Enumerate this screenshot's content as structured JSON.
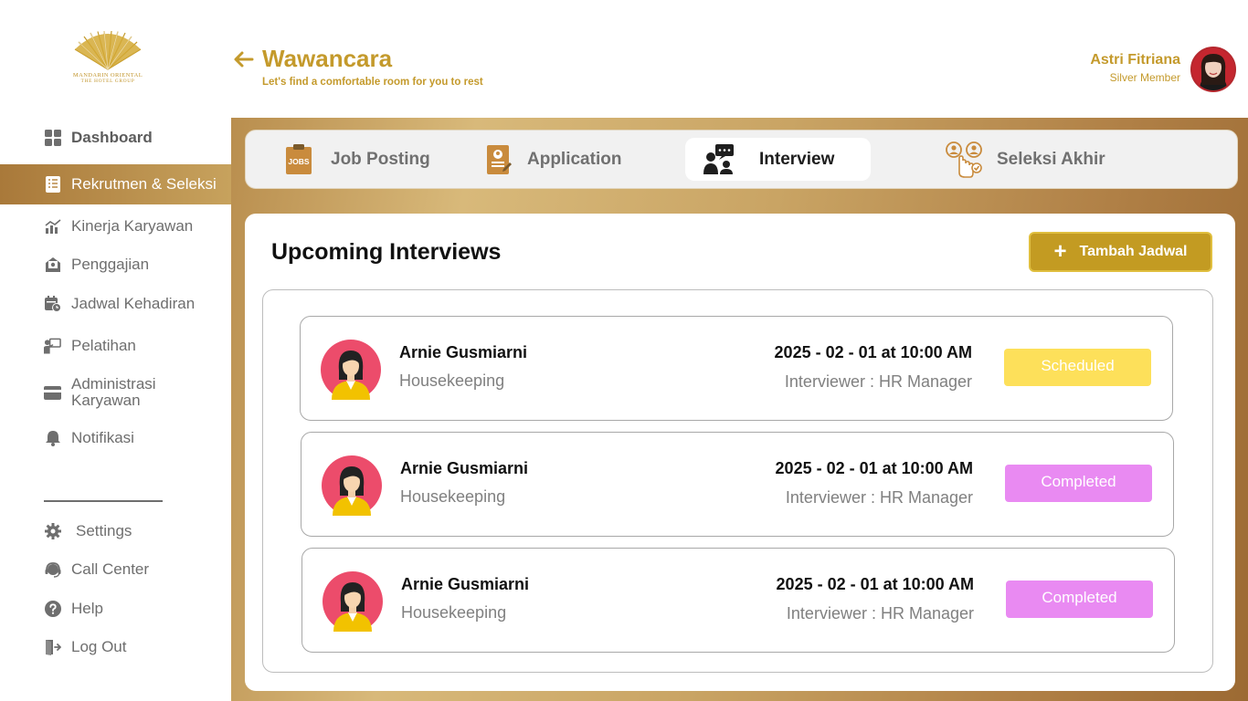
{
  "logo": {
    "line1": "MANDARIN ORIENTAL",
    "line2": "THE HOTEL GROUP"
  },
  "header": {
    "title": "Wawancara",
    "subtitle": "Let's find a comfortable room for you to rest"
  },
  "user": {
    "name": "Astri Fitriana",
    "tier": "Silver Member"
  },
  "sidebar": {
    "items": [
      {
        "label": "Dashboard",
        "icon": "dashboard-icon"
      },
      {
        "label": "Rekrutmen & Seleksi",
        "icon": "document-list-icon"
      },
      {
        "label": "Kinerja Karyawan",
        "icon": "chart-icon"
      },
      {
        "label": "Penggajian",
        "icon": "payroll-icon"
      },
      {
        "label": "Jadwal Kehadiran",
        "icon": "calendar-clock-icon"
      },
      {
        "label": "Pelatihan",
        "icon": "training-icon"
      },
      {
        "label": "Administrasi Karyawan",
        "icon": "card-icon"
      },
      {
        "label": "Notifikasi",
        "icon": "bell-icon"
      }
    ],
    "bottom_items": [
      {
        "label": "Settings",
        "icon": "gear-icon"
      },
      {
        "label": "Call Center",
        "icon": "headset-icon"
      },
      {
        "label": "Help",
        "icon": "help-icon"
      },
      {
        "label": "Log Out",
        "icon": "logout-icon"
      }
    ]
  },
  "tabs": [
    {
      "label": "Job Posting",
      "icon": "jobs-icon",
      "icon_text": "JOBS"
    },
    {
      "label": "Application",
      "icon": "application-icon"
    },
    {
      "label": "Interview",
      "icon": "interview-icon"
    },
    {
      "label": "Seleksi Akhir",
      "icon": "selection-icon"
    }
  ],
  "active_tab": "Interview",
  "main": {
    "section_title": "Upcoming Interviews",
    "add_button_label": "Tambah Jadwal"
  },
  "interviews": [
    {
      "name": "Arnie Gusmiarni",
      "department": "Housekeeping",
      "datetime": "2025 - 02 - 01 at 10:00 AM",
      "interviewer": "Interviewer : HR Manager",
      "status": "Scheduled"
    },
    {
      "name": "Arnie Gusmiarni",
      "department": "Housekeeping",
      "datetime": "2025 - 02 - 01 at 10:00 AM",
      "interviewer": "Interviewer : HR Manager",
      "status": "Completed"
    },
    {
      "name": "Arnie Gusmiarni",
      "department": "Housekeeping",
      "datetime": "2025 - 02 - 01 at 10:00 AM",
      "interviewer": "Interviewer : HR Manager",
      "status": "Completed"
    }
  ],
  "colors": {
    "brand_gold": "#c49a2c",
    "status_scheduled": "#fde05a",
    "status_completed": "#e98af2"
  }
}
